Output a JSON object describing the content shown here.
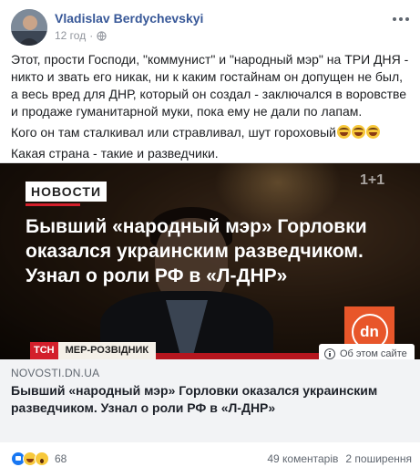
{
  "post": {
    "author": "Vladislav Berdychevskyi",
    "time": "12 год",
    "privacy_icon": "globe-icon",
    "menu_icon": "more-options-icon",
    "paragraphs": [
      "Этот, прости Господи, \"коммунист\" и \"народный мэр\" на ТРИ ДНЯ - никто и звать его никак, ни к каким гостайнам он допущен не был, а весь вред для ДНР, который он создал - заключался в воровстве и продаже гуманитарной муки, пока ему не дали по лапам.",
      "Кого он там сталкивал или стравливал, шут гороховый",
      "Какая страна - такие и разведчики."
    ],
    "emoji_count": 3
  },
  "preview": {
    "channel": "1+1",
    "news_label": "НОВОСТИ",
    "headline": "Бывший «народный мэр» Горловки оказался украинским разведчиком. Узнал о роли РФ в «Л-ДНР»",
    "badge": "dn",
    "tsn_logo": "ТСН",
    "tsn_strap": "МЕР-РОЗВІДНИК",
    "about_site": "Об этом сайте",
    "domain": "NOVOSTI.DN.UA",
    "title": "Бывший «народный мэр» Горловки оказался украинским разведчиком. Узнал о роли РФ в «Л-ДНР»"
  },
  "footer": {
    "reactions": [
      "like-icon",
      "haha-icon",
      "wow-icon"
    ],
    "reaction_count": "68",
    "comments": "49 коментарів",
    "shares": "2 поширення"
  },
  "colors": {
    "author": "#385898",
    "accent_red": "#d31f2b",
    "dn_orange": "#e8562a",
    "caption_bg": "#f2f3f5"
  }
}
